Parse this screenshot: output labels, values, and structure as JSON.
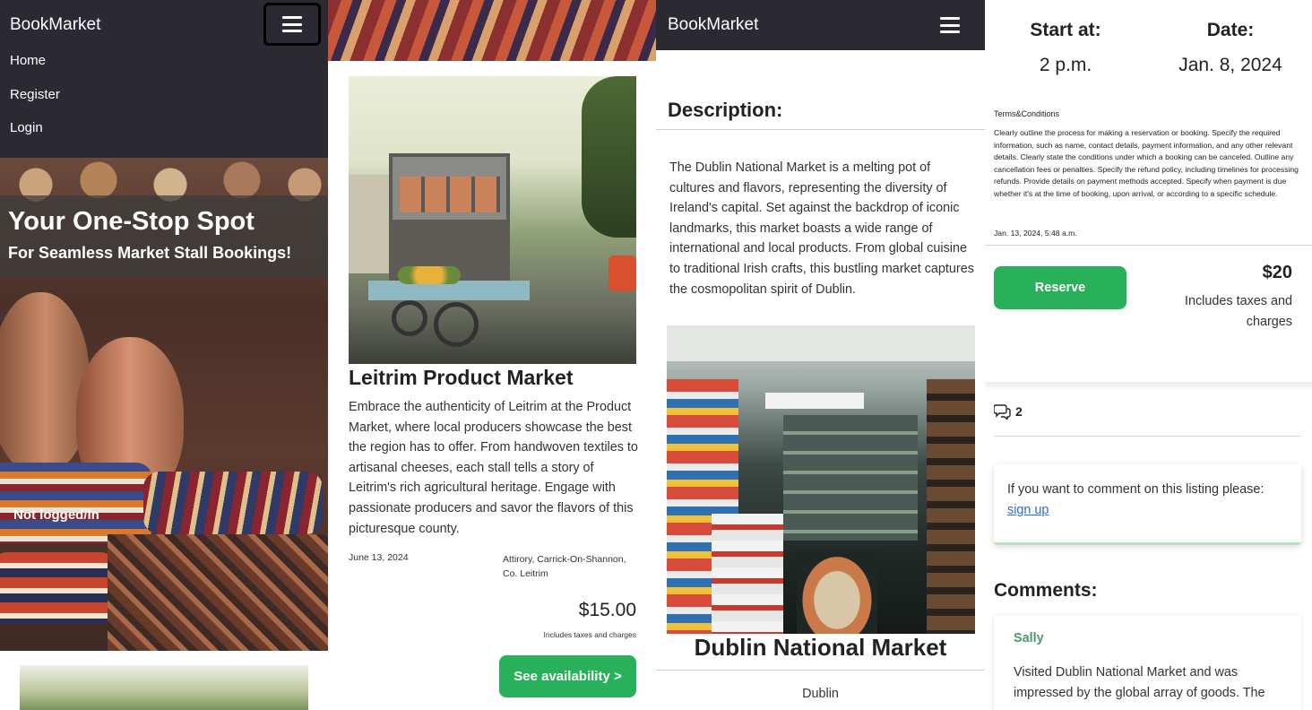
{
  "app": {
    "brand": "BookMarket"
  },
  "panel1": {
    "nav_items": [
      "Home",
      "Register",
      "Login"
    ],
    "hero_title": "Your One-Stop Spot",
    "hero_subtitle": "For Seamless Market Stall Bookings!",
    "status": "Not logged/In"
  },
  "panel2": {
    "title": "Leitrim Product Market",
    "description": "Embrace the authenticity of Leitrim at the Product Market, where local producers showcase the best the region has to offer. From handwoven textiles to artisanal cheeses, each stall tells a story of Leitrim's rich agricultural heritage. Engage with passionate producers and savor the flavors of this picturesque county.",
    "date": "June 13, 2024",
    "location": "Attirory, Carrick-On-Shannon, Co. Leitrim",
    "price": "$15.00",
    "price_note": "Includes taxes and charges",
    "button": "See availability >"
  },
  "panel3": {
    "description_heading": "Description:",
    "description": "The Dublin National Market is a melting pot of cultures and flavors, representing the diversity of Ireland's capital. Set against the backdrop of iconic landmarks, this market boasts a wide range of international and local products. From global cuisine to traditional Irish crafts, this bustling market captures the cosmopolitan spirit of Dublin.",
    "title": "Dublin National Market",
    "city": "Dublin"
  },
  "panel4": {
    "start_label": "Start at:",
    "start_value": "2 p.m.",
    "date_label": "Date:",
    "date_value": "Jan. 8, 2024",
    "terms_heading": "Terms&Conditions",
    "terms_text": "Clearly outline the process for making a reservation or booking. Specify the required information, such as name, contact details, payment information, and any other relevant details. Clearly state the conditions under which a booking can be canceled. Outline any cancellation fees or penalties. Specify the refund policy, including timelines for processing refunds. Provide details on payment methods accepted. Specify when payment is due whether it's at the time of booking, upon arrival, or according to a specific schedule.",
    "terms_timestamp": "Jan. 13, 2024, 5:48 a.m.",
    "reserve_button": "Reserve",
    "price": "$20",
    "price_note": "Includes taxes and charges",
    "comment_count": "2",
    "comment_prompt": "If you want to comment on this listing please:",
    "signup_link": "sign up",
    "comments_heading": "Comments:",
    "comment_author": "Sally",
    "comment_text": "Visited Dublin National Market and was impressed by the global array of goods. The"
  },
  "colors": {
    "navbar": "#2b2a33",
    "accent_green": "#28b05b",
    "link": "#2a6fd6"
  },
  "icons": [
    "hamburger-icon",
    "comments-icon"
  ]
}
